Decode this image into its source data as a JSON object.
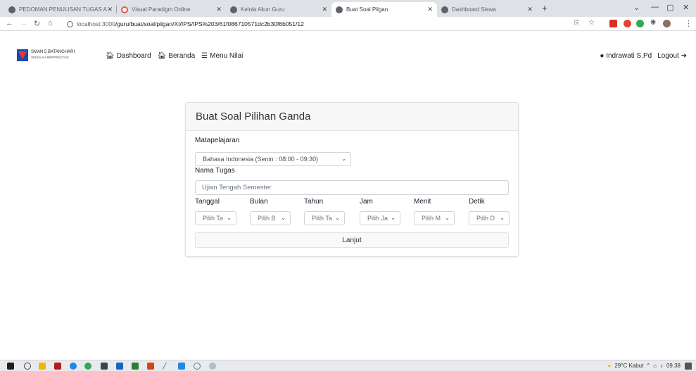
{
  "browser": {
    "tabs": [
      {
        "title": "PEDOMAN PENULISAN TUGAS A",
        "active": false
      },
      {
        "title": "Visual Paradigm Online",
        "active": false
      },
      {
        "title": "Kelola Akun Guru",
        "active": false
      },
      {
        "title": "Buat Soal Pilgan",
        "active": true
      },
      {
        "title": "Dashboard Siswa",
        "active": false
      }
    ],
    "url_host": "localhost:3000",
    "url_path": "/guru/buat/soal/pilgan/XI/IPS/IPS%203/61f086710571dc2b30f6b051/12"
  },
  "navbar": {
    "brand_name": "SMAN 5 BATANGHARI",
    "brand_tagline": "SEKOLAH BERPRESTASI",
    "links": [
      "Dashboard",
      "Beranda",
      "Menu Nilai"
    ],
    "user": "Indrawati S.Pd",
    "logout": "Logout"
  },
  "form": {
    "title": "Buat Soal Pilihan Ganda",
    "subject_label": "Matapelajaran",
    "subject_value": "Bahasa Indonesia (Senin : 08:00 - 09:30)",
    "task_label": "Nama Tugas",
    "task_placeholder": "Ujian Tengah Semester",
    "date_fields": [
      {
        "label": "Tanggal",
        "placeholder": "Pilih Ta"
      },
      {
        "label": "Bulan",
        "placeholder": "Pilih B"
      },
      {
        "label": "Tahun",
        "placeholder": "Pilih Ta"
      },
      {
        "label": "Jam",
        "placeholder": "Pilih Ja"
      },
      {
        "label": "Menit",
        "placeholder": "Pilih M"
      },
      {
        "label": "Detik",
        "placeholder": "Pilih D"
      }
    ],
    "submit_label": "Lanjut"
  },
  "taskbar": {
    "weather": "29°C Kabut",
    "time": "09.38"
  }
}
